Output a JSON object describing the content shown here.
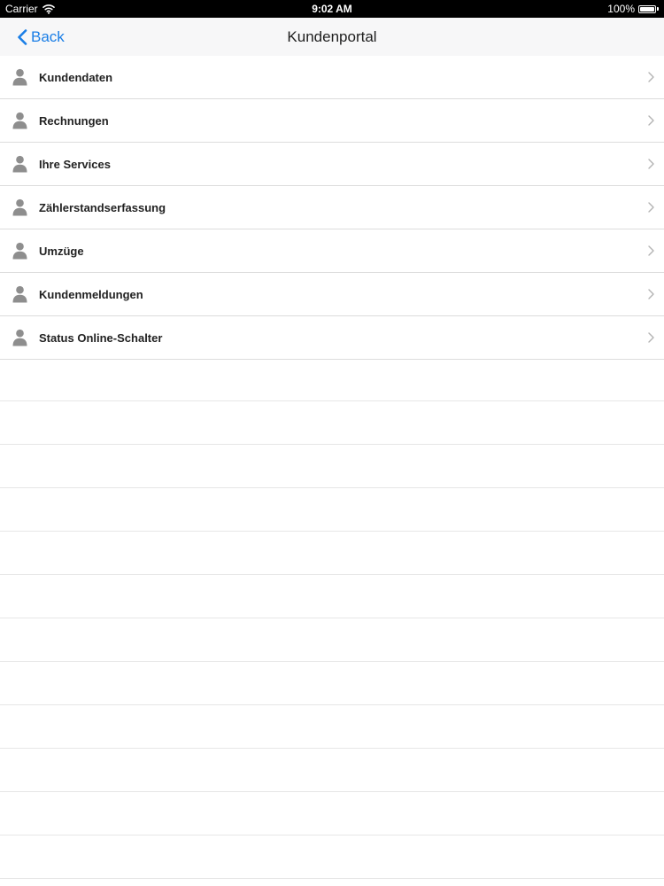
{
  "status_bar": {
    "carrier": "Carrier",
    "time": "9:02 AM",
    "battery": "100%",
    "battery_level": 1.0
  },
  "nav": {
    "back_label": "Back",
    "title": "Kundenportal"
  },
  "menu": {
    "items": [
      {
        "label": "Kundendaten",
        "icon": "person-icon"
      },
      {
        "label": "Rechnungen",
        "icon": "person-icon"
      },
      {
        "label": "Ihre Services",
        "icon": "person-icon"
      },
      {
        "label": "Zählerstandserfassung",
        "icon": "person-icon"
      },
      {
        "label": "Umzüge",
        "icon": "person-icon"
      },
      {
        "label": "Kundenmeldungen",
        "icon": "person-icon"
      },
      {
        "label": "Status Online-Schalter",
        "icon": "person-icon"
      }
    ]
  },
  "colors": {
    "accent": "#1a7ee6",
    "icon_gray": "#8e8e8e",
    "separator": "#dcdcdc",
    "nav_background": "#f7f7f8"
  }
}
